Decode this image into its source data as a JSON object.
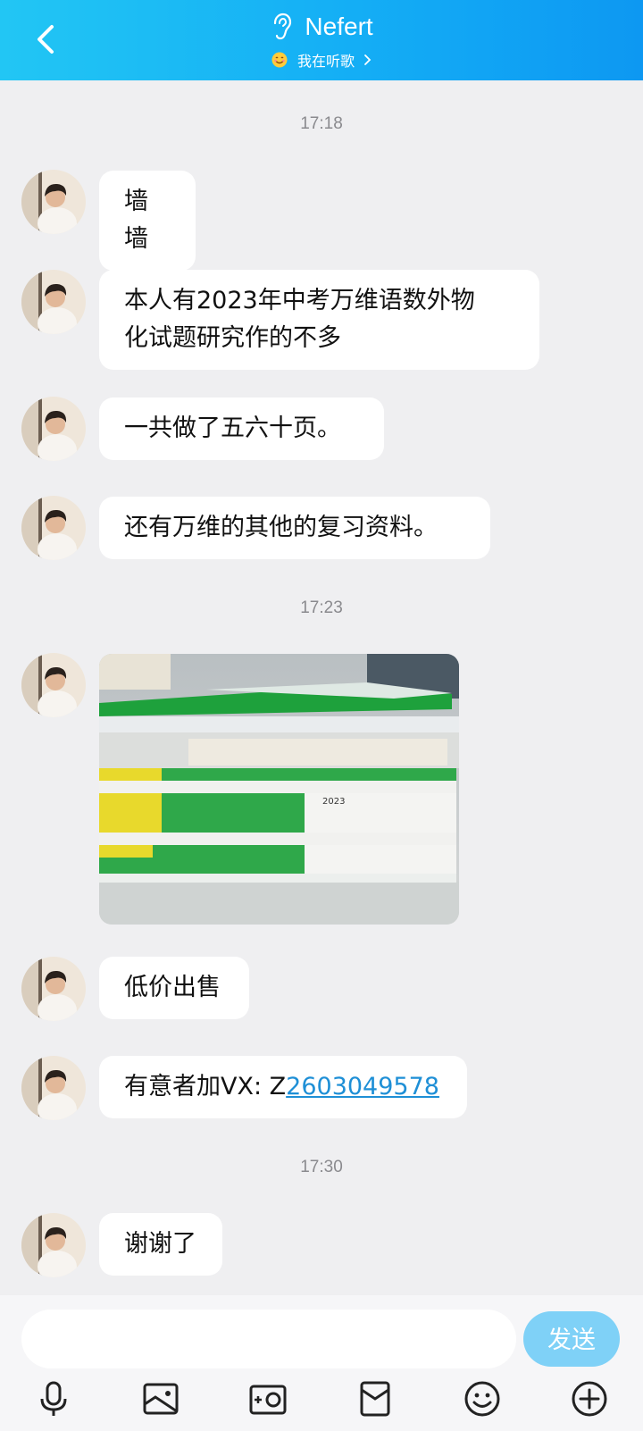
{
  "header": {
    "title": "Nefert",
    "status": "我在听歌"
  },
  "messages": [
    {
      "type": "time",
      "text": "17:18"
    },
    {
      "type": "text",
      "text": "墙墙"
    },
    {
      "type": "text",
      "text": "本人有2023年中考万维语数外物化试题研究作的不多"
    },
    {
      "type": "text",
      "text": "一共做了五六十页。"
    },
    {
      "type": "text",
      "text": "还有万维的其他的复习资料。"
    },
    {
      "type": "time",
      "text": "17:23"
    },
    {
      "type": "image"
    },
    {
      "type": "text",
      "text": "低价出售"
    },
    {
      "type": "text",
      "prefix": "有意者加VX: Z",
      "link": "2603049578"
    },
    {
      "type": "time",
      "text": "17:30"
    },
    {
      "type": "text",
      "text": "谢谢了"
    }
  ],
  "wrapped": {
    "line1": "本人有2023年中考万维语数外物",
    "line2": "化试题研究作的不多"
  },
  "photo": {
    "label_2023": "2023"
  },
  "input": {
    "placeholder": "",
    "send_label": "发送"
  },
  "toolbar": [
    "mic-icon",
    "picture-icon",
    "camera-icon",
    "red-packet-icon",
    "emoji-icon",
    "plus-icon"
  ],
  "colors": {
    "header_start": "#22c6f4",
    "header_end": "#0d98f2",
    "send": "#7fd1f7",
    "link": "#1e8fd6",
    "background": "#efeff1"
  }
}
